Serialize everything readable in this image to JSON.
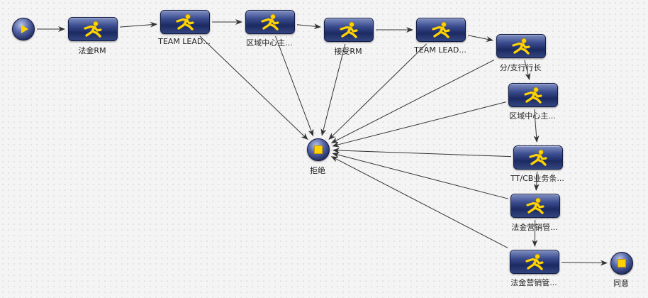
{
  "nodes": [
    {
      "id": "start",
      "kind": "start",
      "label": ""
    },
    {
      "id": "n1",
      "kind": "task",
      "label": "法金RM"
    },
    {
      "id": "n2",
      "kind": "task",
      "label": "TEAM LEAD..."
    },
    {
      "id": "n3",
      "kind": "task",
      "label": "区域中心主..."
    },
    {
      "id": "n4",
      "kind": "task",
      "label": "接受RM"
    },
    {
      "id": "n5",
      "kind": "task",
      "label": "TEAM LEAD..."
    },
    {
      "id": "n6",
      "kind": "task",
      "label": "分/支行行长"
    },
    {
      "id": "n7",
      "kind": "task",
      "label": "区域中心主..."
    },
    {
      "id": "n8",
      "kind": "task",
      "label": "TT/CB业务条..."
    },
    {
      "id": "n9",
      "kind": "task",
      "label": "法金营销管..."
    },
    {
      "id": "n10",
      "kind": "task",
      "label": "法金营销管..."
    },
    {
      "id": "reject",
      "kind": "end",
      "label": "拒绝"
    },
    {
      "id": "agree",
      "kind": "end",
      "label": "同意"
    }
  ],
  "edges": [
    [
      "start",
      "n1"
    ],
    [
      "n1",
      "n2"
    ],
    [
      "n2",
      "n3"
    ],
    [
      "n3",
      "n4"
    ],
    [
      "n4",
      "n5"
    ],
    [
      "n5",
      "n6"
    ],
    [
      "n6",
      "n7"
    ],
    [
      "n7",
      "n8"
    ],
    [
      "n8",
      "n9"
    ],
    [
      "n9",
      "n10"
    ],
    [
      "n10",
      "agree"
    ],
    [
      "n2",
      "reject"
    ],
    [
      "n3",
      "reject"
    ],
    [
      "n4",
      "reject"
    ],
    [
      "n5",
      "reject"
    ],
    [
      "n6",
      "reject"
    ],
    [
      "n7",
      "reject"
    ],
    [
      "n8",
      "reject"
    ],
    [
      "n9",
      "reject"
    ],
    [
      "n10",
      "reject"
    ]
  ],
  "colors": {
    "accent": "#ffd200",
    "node_dark": "#1c2a62",
    "edge": "#333333"
  },
  "icons": {
    "task": "running-person-icon",
    "start": "play-icon",
    "end": "stop-icon"
  }
}
